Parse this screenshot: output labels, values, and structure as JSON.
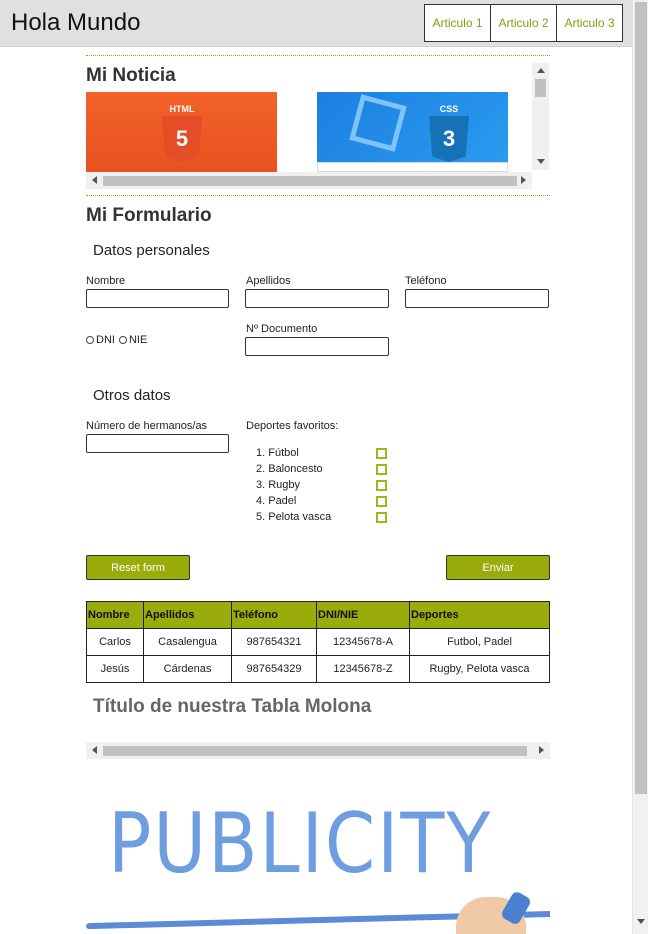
{
  "header": {
    "title": "Hola Mundo",
    "nav": [
      "Articulo 1",
      "Articulo 2",
      "Articulo 3"
    ]
  },
  "noticia": {
    "title": "Mi Noticia",
    "cards": [
      "HTML",
      "CSS"
    ]
  },
  "form": {
    "title": "Mi Formulario",
    "datos_personales": "Datos personales",
    "labels": {
      "nombre": "Nombre",
      "apellidos": "Apellidos",
      "telefono": "Teléfono",
      "documento": "Nº Documento",
      "hermanos": "Número de hermanos/as",
      "deportes": "Deportes favoritos:"
    },
    "radios": [
      "DNI",
      "NIE"
    ],
    "otros_datos": "Otros datos",
    "sports": [
      "1. Fútbol",
      "2. Baloncesto",
      "3. Rugby",
      "4. Padel",
      "5. Pelota vasca"
    ],
    "reset_label": "Reset form",
    "submit_label": "Enviar"
  },
  "table": {
    "headers": [
      "Nombre",
      "Apellidos",
      "Teléfono",
      "DNI/NIE",
      "Deportes"
    ],
    "rows": [
      [
        "Carlos",
        "Casalengua",
        "987654321",
        "12345678-A",
        "Futbol, Padel"
      ],
      [
        "Jesús",
        "Cárdenas",
        "987654329",
        "12345678-Z",
        "Rugby, Pelota vasca"
      ]
    ],
    "title": "Título de nuestra Tabla Molona"
  },
  "ad": {
    "text": "PUBLICITY"
  },
  "colors": {
    "accent": "#9aab0c",
    "nav_text": "#8a9a10",
    "header_bg": "#e0e0e0"
  }
}
